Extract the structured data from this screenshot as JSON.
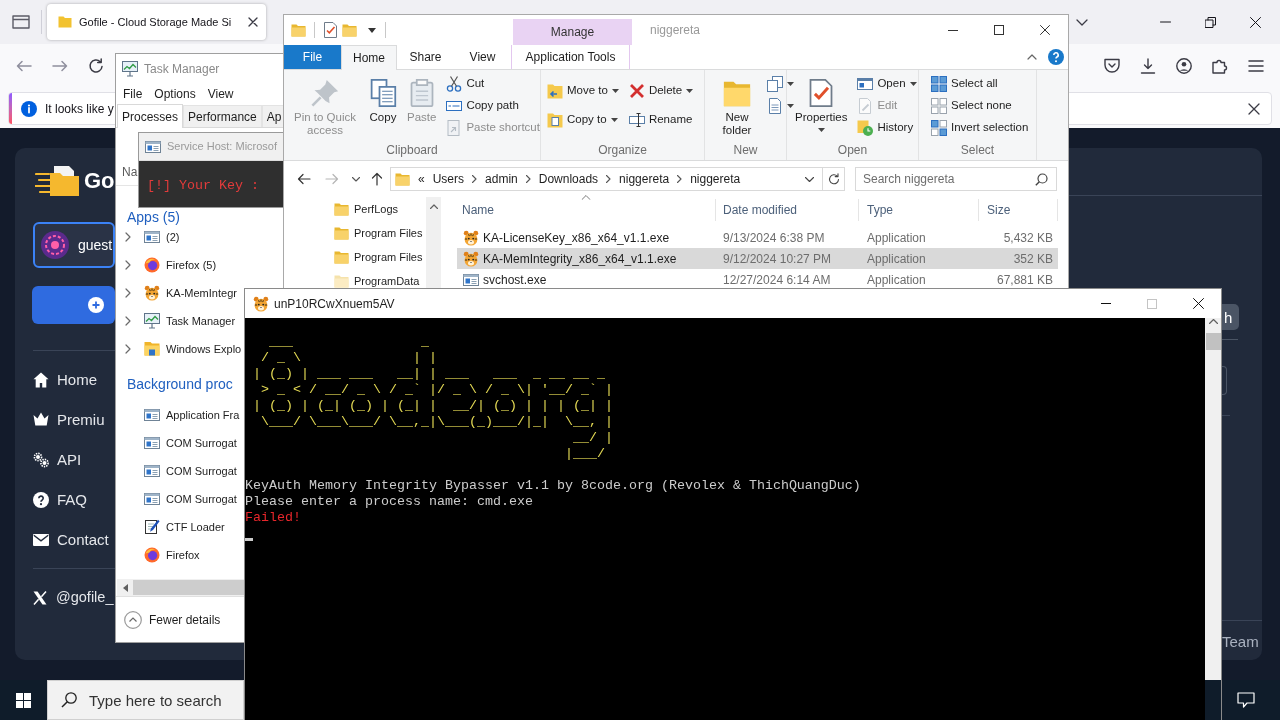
{
  "browser": {
    "tabs": [
      {
        "title": "Gofile - Cloud Storage Made Si",
        "selected": true
      }
    ],
    "notification": {
      "text": "It looks like y"
    },
    "page": {
      "brand": "Go",
      "account": {
        "name": "guest"
      },
      "menu": [
        {
          "label": "Home",
          "kind": "home"
        },
        {
          "label": "Premiu",
          "kind": "premium"
        },
        {
          "label": "API",
          "kind": "api"
        },
        {
          "label": "FAQ",
          "kind": "faq"
        },
        {
          "label": "Contact",
          "kind": "contact"
        }
      ],
      "social": {
        "label": "@gofile_"
      },
      "side_button": {
        "label": "h"
      },
      "footer": {
        "label": "Team"
      }
    }
  },
  "task_manager": {
    "title": "Task Manager",
    "menu": [
      "File",
      "Options",
      "View"
    ],
    "tabs": [
      {
        "label": "Processes",
        "selected": true
      },
      {
        "label": "Performance",
        "selected": false
      },
      {
        "label": "Ap",
        "selected": false
      }
    ],
    "column_header": "Na",
    "sections": [
      {
        "heading": "Apps (5)",
        "rows": [
          {
            "name": "(2)",
            "kind": "app",
            "expanded": false
          },
          {
            "name": "Firefox (5)",
            "kind": "firefox",
            "expanded": false
          },
          {
            "name": "KA-MemIntegr",
            "kind": "tiger",
            "expanded": false
          },
          {
            "name": "Task Manager",
            "kind": "monitor",
            "expanded": false
          },
          {
            "name": "Windows Explo",
            "kind": "explorer",
            "expanded": false
          }
        ]
      },
      {
        "heading": "Background proc",
        "rows": [
          {
            "name": "Application Fra",
            "kind": "app"
          },
          {
            "name": "COM Surrogat",
            "kind": "app"
          },
          {
            "name": "COM Surrogat",
            "kind": "app"
          },
          {
            "name": "COM Surrogat",
            "kind": "app"
          },
          {
            "name": "CTF Loader",
            "kind": "notepad"
          },
          {
            "name": "Firefox",
            "kind": "firefox"
          }
        ]
      }
    ],
    "footer": {
      "label": "Fewer details"
    }
  },
  "key_prompt": {
    "title": "Service Host: Microsof",
    "text": "[!] Your Key :"
  },
  "explorer": {
    "context_header": "Manage",
    "title": "niggereta",
    "ribbon_tabs": [
      {
        "label": "File",
        "kind": "backstage",
        "selected": false
      },
      {
        "label": "Home",
        "kind": "tab",
        "selected": true
      },
      {
        "label": "Share",
        "kind": "tab",
        "selected": false
      },
      {
        "label": "View",
        "kind": "tab",
        "selected": false
      },
      {
        "label": "Application Tools",
        "kind": "context",
        "selected": false
      }
    ],
    "groups": [
      {
        "label": "Clipboard",
        "columns": [
          [
            {
              "label": "Pin to Quick access",
              "kind": "pin",
              "disabled": true,
              "menu": false
            }
          ],
          [
            {
              "label": "Copy",
              "kind": "copy",
              "disabled": false,
              "menu": false
            }
          ],
          [
            {
              "label": "Paste",
              "kind": "paste",
              "disabled": true,
              "menu": false
            }
          ],
          [
            {
              "label": "Cut",
              "kind": "cut",
              "disabled": false,
              "menu": false
            },
            {
              "label": "Copy path",
              "kind": "copypath",
              "disabled": false,
              "menu": false
            },
            {
              "label": "Paste shortcut",
              "kind": "shortcut",
              "disabled": true,
              "menu": false
            }
          ]
        ]
      },
      {
        "label": "Organize",
        "columns": [
          [
            {
              "label": "Move to",
              "kind": "move",
              "disabled": false,
              "menu": true
            },
            {
              "label": "Copy to",
              "kind": "copyto",
              "disabled": false,
              "menu": true
            }
          ],
          [
            {
              "label": "Delete",
              "kind": "delete",
              "disabled": false,
              "menu": true
            },
            {
              "label": "Rename",
              "kind": "rename",
              "disabled": false,
              "menu": false
            }
          ]
        ]
      },
      {
        "label": "New",
        "columns": [
          [
            {
              "label": "New folder",
              "kind": "newfolder",
              "disabled": false,
              "menu": false
            }
          ],
          [
            {
              "kind": "newitem",
              "disabled": false,
              "menu": true
            },
            {
              "kind": "easyaccess",
              "disabled": false,
              "menu": true
            }
          ]
        ]
      },
      {
        "label": "Open",
        "columns": [
          [
            {
              "label": "Properties",
              "kind": "properties",
              "disabled": false,
              "menu": true
            }
          ],
          [
            {
              "label": "Open",
              "kind": "open",
              "disabled": false,
              "menu": true
            },
            {
              "label": "Edit",
              "kind": "edit",
              "disabled": true,
              "menu": false
            },
            {
              "label": "History",
              "kind": "history",
              "disabled": false,
              "menu": false
            }
          ]
        ]
      },
      {
        "label": "Select",
        "columns": [
          [
            {
              "label": "Select all",
              "kind": "selectall",
              "disabled": false,
              "menu": false
            },
            {
              "label": "Select none",
              "kind": "selectnone",
              "disabled": false,
              "menu": false
            },
            {
              "label": "Invert selection",
              "kind": "invert",
              "disabled": false,
              "menu": false
            }
          ]
        ]
      }
    ],
    "address": {
      "overflow": "«",
      "crumbs": [
        "Users",
        "admin",
        "Downloads",
        "niggereta",
        "niggereta"
      ]
    },
    "search": {
      "placeholder": "Search niggereta"
    },
    "tree": [
      {
        "label": "PerfLogs",
        "kind": "folder"
      },
      {
        "label": "Program Files",
        "kind": "folder"
      },
      {
        "label": "Program Files",
        "kind": "folder"
      },
      {
        "label": "ProgramData",
        "kind": "hidden"
      }
    ],
    "columns": [
      {
        "label": "Name",
        "sorted": true
      },
      {
        "label": "Date modified",
        "sorted": false
      },
      {
        "label": "Type",
        "sorted": false
      },
      {
        "label": "Size",
        "sorted": false
      }
    ],
    "files": [
      {
        "name": "KA-LicenseKey_x86_x64_v1.1.exe",
        "date": "9/13/2024 6:38 PM",
        "type": "Application",
        "size": "5,432 KB",
        "kind": "tiger",
        "selected": false
      },
      {
        "name": "KA-MemIntegrity_x86_x64_v1.1.exe",
        "date": "9/12/2024 10:27 PM",
        "type": "Application",
        "size": "352 KB",
        "kind": "tiger",
        "selected": true
      },
      {
        "name": "svchost.exe",
        "date": "12/27/2024 6:14 AM",
        "type": "Application",
        "size": "67,881 KB",
        "kind": "app",
        "selected": false
      }
    ]
  },
  "console": {
    "title": "unP10RCwXnuem5AV",
    "art": [
      "   ___                _",
      "  / _ \\              | |",
      " | (_) | ___ ___   __| | ___   ___  _ __ __ _",
      "  > _ < / __/ _ \\ / _` |/ _ \\ / _ \\| '__/ _` |",
      " | (_) | (_| (_) | (_| |  __/| (_) | | | (_| |",
      "  \\___/ \\___\\___/ \\__,_|\\___(_)___/|_|  \\__, |",
      "                                         __/ |",
      "                                        |___/"
    ],
    "lines": [
      {
        "text": "KeyAuth Memory Integrity Bypasser v1.1 by 8code.org (Revolex & ThichQuangDuc)",
        "kind": "output"
      },
      {
        "text": "Please enter a process name: cmd.exe",
        "kind": "output"
      },
      {
        "text": "Failed!",
        "kind": "error"
      }
    ],
    "cursor": true
  },
  "taskbar": {
    "search": {
      "placeholder": "Type here to search"
    }
  }
}
